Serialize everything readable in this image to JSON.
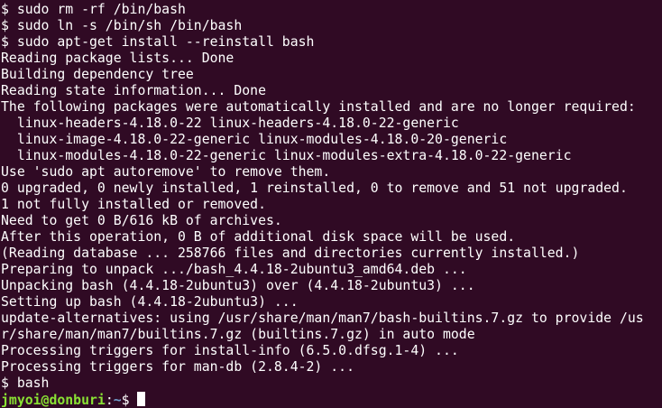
{
  "terminal": {
    "lines": [
      "$ sudo rm -rf /bin/bash",
      "$ sudo ln -s /bin/sh /bin/bash",
      "$ sudo apt-get install --reinstall bash",
      "Reading package lists... Done",
      "Building dependency tree",
      "Reading state information... Done",
      "The following packages were automatically installed and are no longer required:",
      "  linux-headers-4.18.0-22 linux-headers-4.18.0-22-generic",
      "  linux-image-4.18.0-22-generic linux-modules-4.18.0-20-generic",
      "  linux-modules-4.18.0-22-generic linux-modules-extra-4.18.0-22-generic",
      "Use 'sudo apt autoremove' to remove them.",
      "0 upgraded, 0 newly installed, 1 reinstalled, 0 to remove and 51 not upgraded.",
      "1 not fully installed or removed.",
      "Need to get 0 B/616 kB of archives.",
      "After this operation, 0 B of additional disk space will be used.",
      "(Reading database ... 258766 files and directories currently installed.)",
      "Preparing to unpack .../bash_4.4.18-2ubuntu3_amd64.deb ...",
      "Unpacking bash (4.4.18-2ubuntu3) over (4.4.18-2ubuntu3) ...",
      "Setting up bash (4.4.18-2ubuntu3) ...",
      "update-alternatives: using /usr/share/man/man7/bash-builtins.7.gz to provide /us",
      "r/share/man/man7/builtins.7.gz (builtins.7.gz) in auto mode",
      "Processing triggers for install-info (6.5.0.dfsg.1-4) ...",
      "Processing triggers for man-db (2.8.4-2) ...",
      "$ bash"
    ],
    "prompt": {
      "user_host": "jmyoi@donburi",
      "separator": ":",
      "path": "~",
      "symbol": "$ "
    },
    "colors": {
      "background": "#300a24",
      "foreground": "#ffffff",
      "user_host": "#8ae234",
      "path": "#729fcf"
    }
  }
}
